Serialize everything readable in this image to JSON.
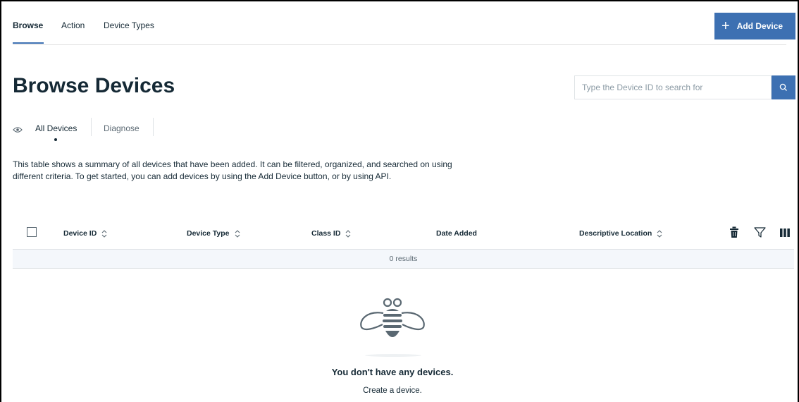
{
  "topnav": {
    "tabs": [
      {
        "label": "Browse",
        "active": true
      },
      {
        "label": "Action",
        "active": false
      },
      {
        "label": "Device Types",
        "active": false
      }
    ],
    "add_button": {
      "icon": "plus-icon",
      "label": "Add Device"
    }
  },
  "page": {
    "title": "Browse Devices",
    "search": {
      "placeholder": "Type the Device ID to search for",
      "value": "",
      "icon": "search-icon"
    },
    "subtabs": [
      {
        "icon": "eye-icon",
        "label": "All Devices",
        "active": true
      },
      {
        "label": "Diagnose",
        "active": false
      }
    ],
    "description": "This table shows a summary of all devices that have been added. It can be filtered, organized, and searched on using different criteria. To get started, you can add devices by using the Add Device button, or by using API."
  },
  "table": {
    "columns": [
      {
        "label": "Device ID",
        "sortable": true
      },
      {
        "label": "Device Type",
        "sortable": true
      },
      {
        "label": "Class ID",
        "sortable": true
      },
      {
        "label": "Date Added",
        "sortable": false
      },
      {
        "label": "Descriptive Location",
        "sortable": true
      }
    ],
    "toolbar_icons": [
      "trash-icon",
      "filter-icon",
      "columns-icon"
    ],
    "results_text": "0 results",
    "rows": []
  },
  "empty_state": {
    "icon": "bee-icon",
    "title": "You don't have any devices.",
    "subtitle": "Create a device."
  },
  "colors": {
    "accent": "#3d70b2",
    "text": "#152935",
    "muted": "#5a6872",
    "border": "#dfe3e6"
  }
}
